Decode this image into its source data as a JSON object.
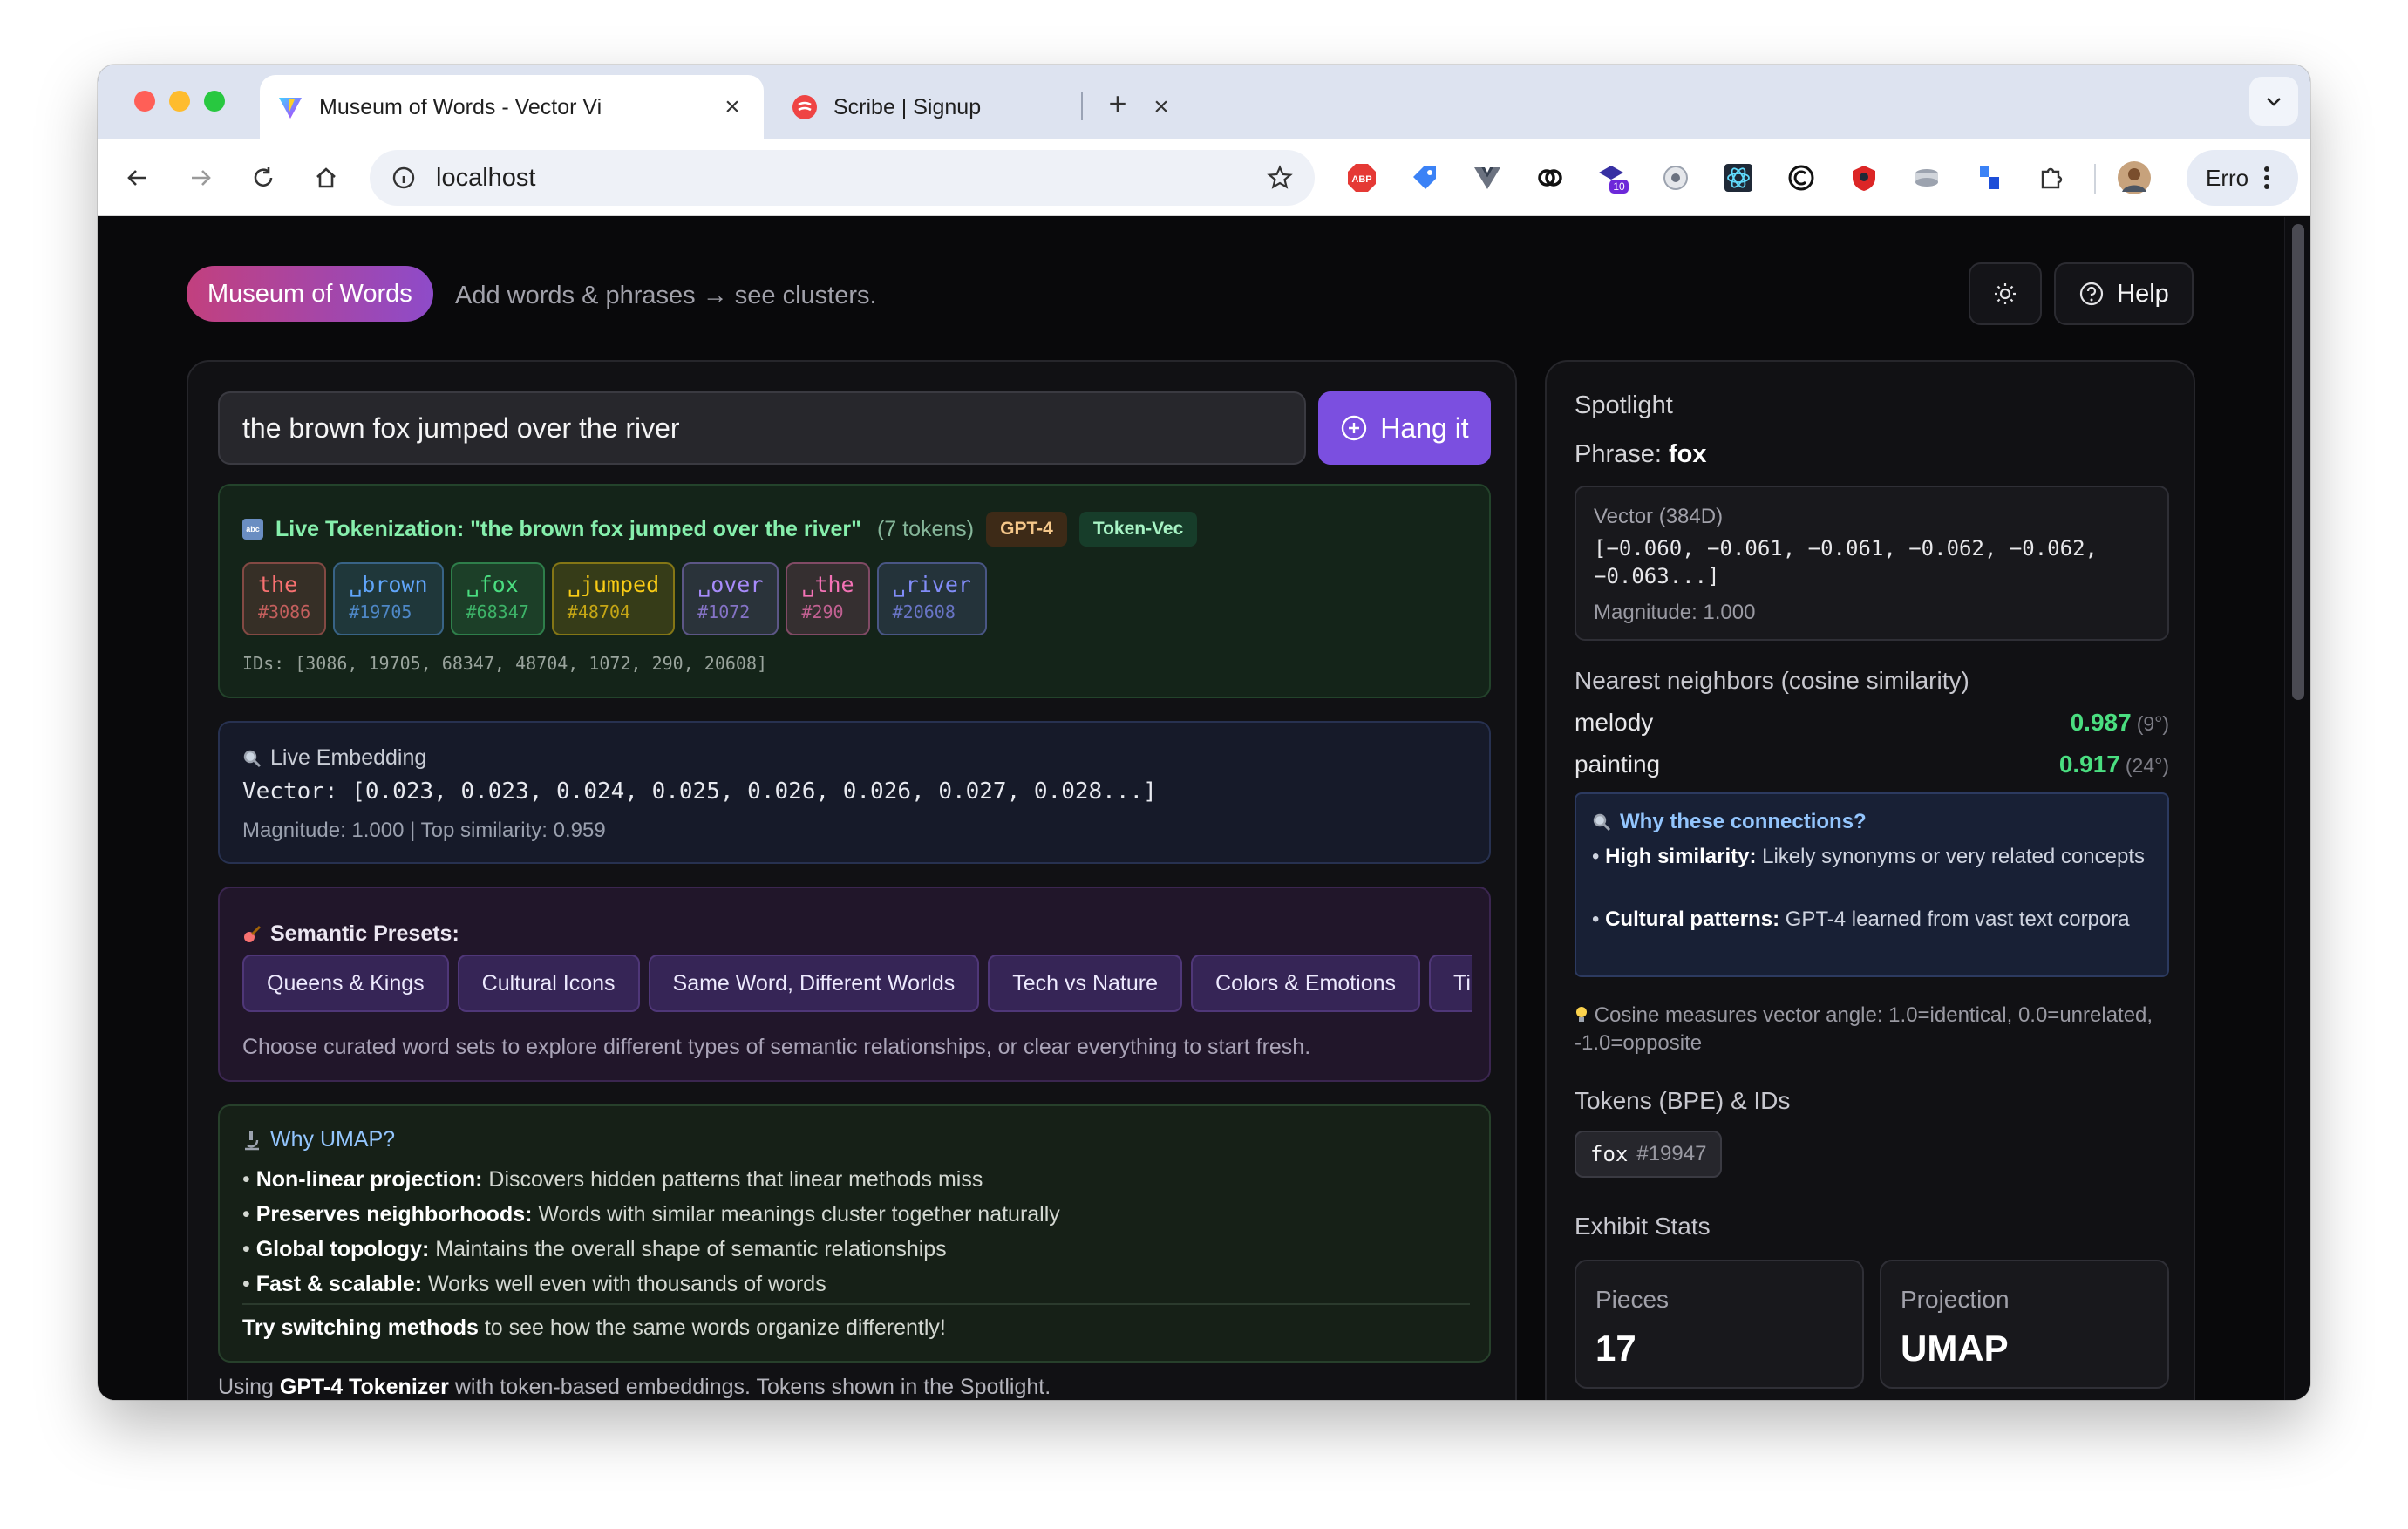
{
  "browser": {
    "tabs": [
      {
        "title": "Museum of Words - Vector Vi",
        "active": true,
        "favicon": "vite-icon"
      },
      {
        "title": "Scribe | Signup",
        "active": false,
        "favicon": "scribe-icon"
      }
    ],
    "url": "localhost",
    "profile_label": "Erro",
    "extensions": [
      "adblock-icon",
      "tag-icon",
      "vue-icon",
      "link-icon",
      "hat-icon",
      "clock-icon",
      "react-icon",
      "copyright-icon",
      "shield-icon",
      "disk-icon",
      "blocks-icon",
      "puzzle-icon"
    ],
    "extension_badge": "10"
  },
  "header": {
    "brand": "Museum of Words",
    "tagline": "Add words & phrases → see clusters.",
    "help_label": "Help"
  },
  "input": {
    "value": "the brown fox jumped over the river",
    "submit_label": "Hang it"
  },
  "tokenization": {
    "title": "Live Tokenization: \"the brown fox jumped over the river\"",
    "count_label": "(7 tokens)",
    "badge_tokenizer": "GPT-4",
    "badge_mode": "Token-Vec",
    "tokens": [
      {
        "text": "the",
        "id": "#3086"
      },
      {
        "text": "␣brown",
        "id": "#19705"
      },
      {
        "text": "␣fox",
        "id": "#68347"
      },
      {
        "text": "␣jumped",
        "id": "#48704"
      },
      {
        "text": "␣over",
        "id": "#1072"
      },
      {
        "text": "␣the",
        "id": "#290"
      },
      {
        "text": "␣river",
        "id": "#20608"
      }
    ],
    "ids_line": "IDs: [3086, 19705, 68347, 48704, 1072, 290, 20608]",
    "token_colors": [
      "#f87171",
      "#60a5fa",
      "#4ade80",
      "#facc15",
      "#a78bfa",
      "#f472b6",
      "#818cf8"
    ]
  },
  "embedding": {
    "title": "Live Embedding",
    "vector": "Vector: [0.023, 0.023, 0.024, 0.025, 0.026, 0.026, 0.027, 0.028...]",
    "stats": "Magnitude: 1.000 | Top similarity: 0.959"
  },
  "presets": {
    "title": "Semantic Presets:",
    "items": [
      "Queens & Kings",
      "Cultural Icons",
      "Same Word, Different Worlds",
      "Tech vs Nature",
      "Colors & Emotions",
      "Tim"
    ],
    "note": "Choose curated word sets to explore different types of semantic relationships, or clear everything to start fresh."
  },
  "umap": {
    "title": "Why UMAP?",
    "points": [
      {
        "label": "Non-linear projection:",
        "text": "Discovers hidden patterns that linear methods miss"
      },
      {
        "label": "Preserves neighborhoods:",
        "text": "Words with similar meanings cluster together naturally"
      },
      {
        "label": "Global topology:",
        "text": "Maintains the overall shape of semantic relationships"
      },
      {
        "label": "Fast & scalable:",
        "text": "Works well even with thousands of words"
      }
    ],
    "try_bold": "Try switching methods",
    "try_rest": "to see how the same words organize differently!"
  },
  "footer": {
    "pre": "Using",
    "bold": "GPT-4 Tokenizer",
    "post": "with token-based embeddings. Tokens shown in the Spotlight."
  },
  "spotlight": {
    "title": "Spotlight",
    "phrase_label": "Phrase:",
    "phrase": "fox",
    "vector_label": "Vector (384D)",
    "vector_values": "[−0.060, −0.061, −0.061, −0.062, −0.062, −0.063...]",
    "magnitude": "Magnitude: 1.000",
    "neighbors_title": "Nearest neighbors (cosine similarity)",
    "neighbors": [
      {
        "word": "melody",
        "score": "0.987",
        "angle": "(9°)"
      },
      {
        "word": "painting",
        "score": "0.917",
        "angle": "(24°)"
      }
    ],
    "why_title": "Why these connections?",
    "why_points": [
      {
        "label": "High similarity:",
        "text": "Likely synonyms or very related concepts"
      },
      {
        "label": "Cultural patterns:",
        "text": "GPT-4 learned from vast text corpora"
      }
    ],
    "cosine_note": "Cosine measures vector angle: 1.0=identical, 0.0=unrelated, -1.0=opposite",
    "tokens_title": "Tokens (BPE) & IDs",
    "token_word": "fox",
    "token_id": "#19947",
    "stats_title": "Exhibit Stats",
    "stats": [
      {
        "label": "Pieces",
        "value": "17"
      },
      {
        "label": "Projection",
        "value": "UMAP"
      }
    ]
  }
}
